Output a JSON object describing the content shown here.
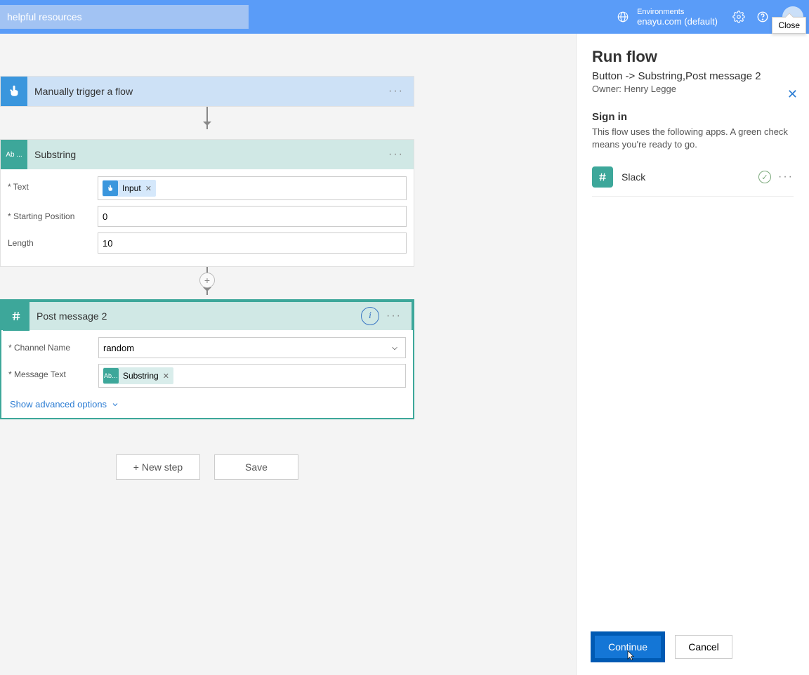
{
  "header": {
    "search_placeholder": "helpful resources",
    "env_label": "Environments",
    "env_name": "enayu.com (default)",
    "tooltip_close": "Close"
  },
  "canvas": {
    "trigger": {
      "title": "Manually trigger a flow"
    },
    "substring": {
      "title": "Substring",
      "text_label": "Text",
      "text_token": "Input",
      "start_label": "Starting Position",
      "start_value": "0",
      "length_label": "Length",
      "length_value": "10"
    },
    "post": {
      "title": "Post message 2",
      "channel_label": "Channel Name",
      "channel_value": "random",
      "msg_label": "Message Text",
      "msg_token": "Substring",
      "advanced": "Show advanced options"
    },
    "new_step": "+ New step",
    "save": "Save"
  },
  "panel": {
    "title": "Run flow",
    "subtitle": "Button -> Substring,Post message 2",
    "owner_label": "Owner: Henry Legge",
    "signin_heading": "Sign in",
    "signin_desc": "This flow uses the following apps. A green check means you're ready to go.",
    "app_name": "Slack",
    "continue": "Continue",
    "cancel": "Cancel"
  }
}
